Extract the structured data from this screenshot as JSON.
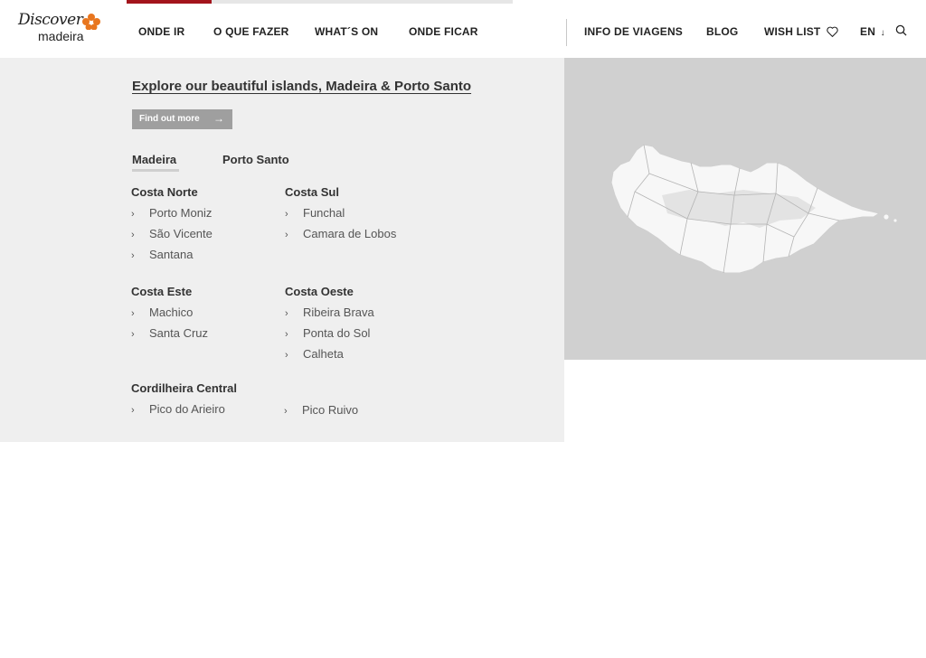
{
  "brand": {
    "script": "Discover",
    "word": "madeira"
  },
  "nav": {
    "main": [
      "ONDE IR",
      "O QUE FAZER",
      "WHAT´S ON",
      "ONDE FICAR"
    ],
    "secondary": {
      "travel_info": "INFO DE VIAGENS",
      "blog": "BLOG",
      "wishlist": "WISH LIST",
      "language": "EN"
    }
  },
  "colors": {
    "accent": "#a3141c",
    "left_panel": "#efefef",
    "map_panel": "#d0d0d0"
  },
  "progress_fraction": 0.22,
  "menu": {
    "headline": "Explore our beautiful islands, Madeira & Porto Santo",
    "cta": "Find out more",
    "tabs": [
      "Madeira",
      "Porto Santo"
    ],
    "active_tab": "Madeira",
    "regions": [
      {
        "name": "Costa Norte",
        "items": [
          "Porto Moniz",
          "São Vicente",
          "Santana"
        ]
      },
      {
        "name": "Costa Sul",
        "items": [
          "Funchal",
          "Camara de Lobos"
        ]
      },
      {
        "name": "Costa Este",
        "items": [
          "Machico",
          "Santa Cruz"
        ]
      },
      {
        "name": "Costa Oeste",
        "items": [
          "Ribeira Brava",
          "Ponta do Sol",
          "Calheta"
        ]
      },
      {
        "name": "Cordilheira Central",
        "items": [
          "Pico do Arieiro",
          "Pico Ruivo"
        ]
      }
    ]
  },
  "icons": {
    "chevron": "›",
    "arrow": "→",
    "heart": "heart-icon",
    "search": "search-icon",
    "language_arrow": "↓"
  }
}
